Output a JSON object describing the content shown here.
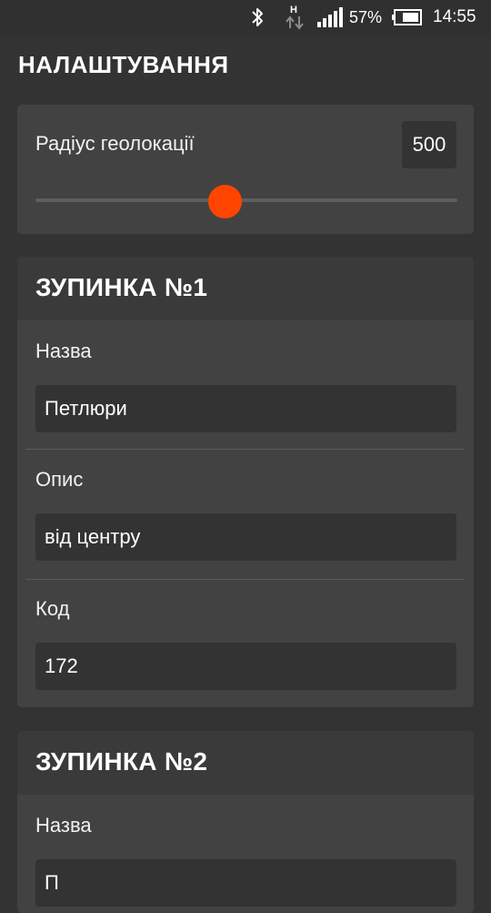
{
  "status_bar": {
    "battery_percent": "57%",
    "time": "14:55",
    "icons": [
      "bluetooth-icon",
      "network-activity-icon",
      "signal-icon",
      "battery-icon"
    ]
  },
  "page": {
    "title": "НАЛАШТУВАННЯ"
  },
  "radius": {
    "label": "Радіус геолокації",
    "value": "500",
    "slider_fraction": 0.45,
    "thumb_color": "#ff4500"
  },
  "stops": [
    {
      "title": "ЗУПИНКА №1",
      "name_label": "Назва",
      "name_value": "Петлюри",
      "description_label": "Опис",
      "description_value": "від центру",
      "code_label": "Код",
      "code_value": "172"
    },
    {
      "title": "ЗУПИНКА №2",
      "name_label": "Назва",
      "name_value": "П"
    }
  ]
}
